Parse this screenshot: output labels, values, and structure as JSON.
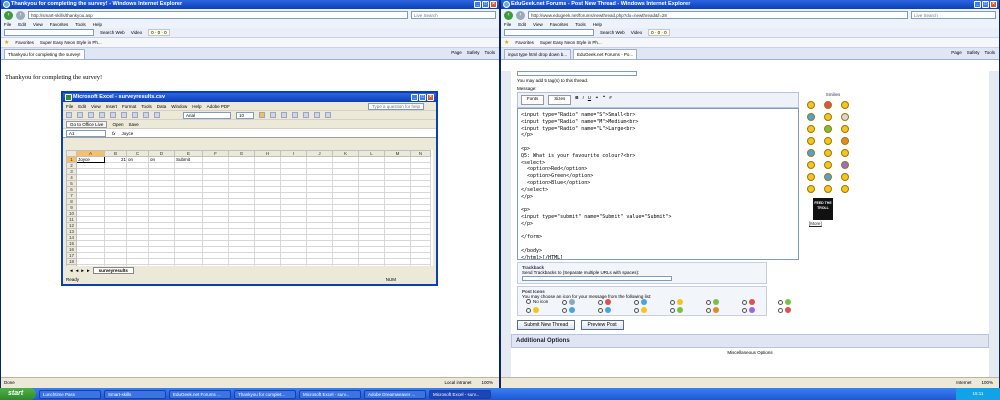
{
  "left_window": {
    "title": "Thankyou for completing the survey! - Windows Internet Explorer",
    "address": "http://smart-skills/thankyou.asp",
    "search_placeholder": "Live Search",
    "menu": [
      "File",
      "Edit",
      "View",
      "Favorites",
      "Tools",
      "Help"
    ],
    "toolbar_search": "Search Web",
    "toolbar_video": "Video",
    "favorites_label": "Favorites",
    "fav_link": "Super Easy Neon Style in Ph...",
    "tab": "Thankyou for completing the survey!",
    "tools": [
      "Page",
      "Safety",
      "Tools"
    ],
    "page_text": "Thankyou for completing the survey!",
    "status_left": "Done",
    "status_zone": "Local intranet",
    "zoom": "100%"
  },
  "excel": {
    "title": "Microsoft Excel - surveyresults.csv",
    "menu": [
      "File",
      "Edit",
      "View",
      "Insert",
      "Format",
      "Tools",
      "Data",
      "Window",
      "Help",
      "Adobe PDF"
    ],
    "help_placeholder": "Type a question for help",
    "font": "Arial",
    "font_size": "10",
    "office_live": "Go to Office Live",
    "open_label": "Open",
    "save_label": "Save",
    "name_box": "A1",
    "formula": "Joyce",
    "columns": [
      "A",
      "B",
      "C",
      "D",
      "E",
      "F",
      "G",
      "H",
      "I",
      "J",
      "K",
      "L",
      "M",
      "N"
    ],
    "row1": [
      "Joyce",
      "21",
      "on",
      "on",
      "Submit",
      "",
      "",
      "",
      "",
      "",
      "",
      "",
      "",
      ""
    ],
    "rows": [
      "1",
      "2",
      "3",
      "4",
      "5",
      "6",
      "7",
      "8",
      "9",
      "10",
      "11",
      "12",
      "13",
      "14",
      "15",
      "16",
      "17",
      "18",
      "19",
      "20",
      "21",
      "22",
      "23",
      "24",
      "25"
    ],
    "sheet_tab": "surveyresults",
    "status_ready": "Ready",
    "status_num": "NUM"
  },
  "right_window": {
    "title": "EduGeek.net Forums - Post New Thread - Windows Internet Explorer",
    "address": "http://www.edugeek.net/forums/newthread.php?do=newthread&f=28",
    "search_placeholder": "Live Search",
    "menu": [
      "File",
      "Edit",
      "View",
      "Favorites",
      "Tools",
      "Help"
    ],
    "toolbar_search": "Search Web",
    "toolbar_video": "Video",
    "favorites_label": "Favorites",
    "fav_link": "Super Easy Neon Style in Ph...",
    "tab1": "input type html drop down b...",
    "tab2": "EduGeek.net Forums - Po...",
    "tools": [
      "Page",
      "Safety",
      "Tools"
    ],
    "tag_hint": "You may add 5 tag(s) to this thread.",
    "message_label": "Message:",
    "fonts_label": "Fonts",
    "sizes_label": "Sizes",
    "code_text": "<input type=\"Radio\" name=\"S\">Small<br>\n<input type=\"Radio\" name=\"M\">Medium<br>\n<input type=\"Radio\" name=\"L\">Large<br>\n</p>\n\n<p>\nQ5: What is your favourite colour?<br>\n<select>\n  <option>Red</option>\n  <option>Green</option>\n  <option>Blue</option>\n</select>\n</p>\n\n<p>\n<input type=\"submit\" name=\"Submit\" value=\"Submit\">\n</p>\n\n</form>\n\n</body>\n</html>[/HTML]\n\nI'm getting the following reslults in a csv file... where 'On' should be a value selected by the student.",
    "smilies_label": "Smilies",
    "more_label": "[More]",
    "feed_label": "FEED THE TROLL",
    "trackback_head": "Trackback",
    "trackback_text": "Send Trackbacks to (Separate multiple URLs with spaces):",
    "posticon_head": "Post Icons",
    "posticon_text": "You may choose an icon for your message from the following list:",
    "no_icon": "No icon",
    "submit_btn": "Submit New Thread",
    "preview_btn": "Preview Post",
    "additional": "Additional Options",
    "misc": "Miscellaneous Options",
    "status_zone": "Internet",
    "zoom": "100%"
  },
  "taskbar": {
    "start": "start",
    "items": [
      "Lunchtime Pass",
      "Smart-skills",
      "EduGeek.net Forums ...",
      "Thankyou for complet...",
      "Microsoft Excel - surv...",
      "Adobe Dreamweaver ...",
      "Microsoft Excel - surv..."
    ],
    "clock": "15:11"
  }
}
